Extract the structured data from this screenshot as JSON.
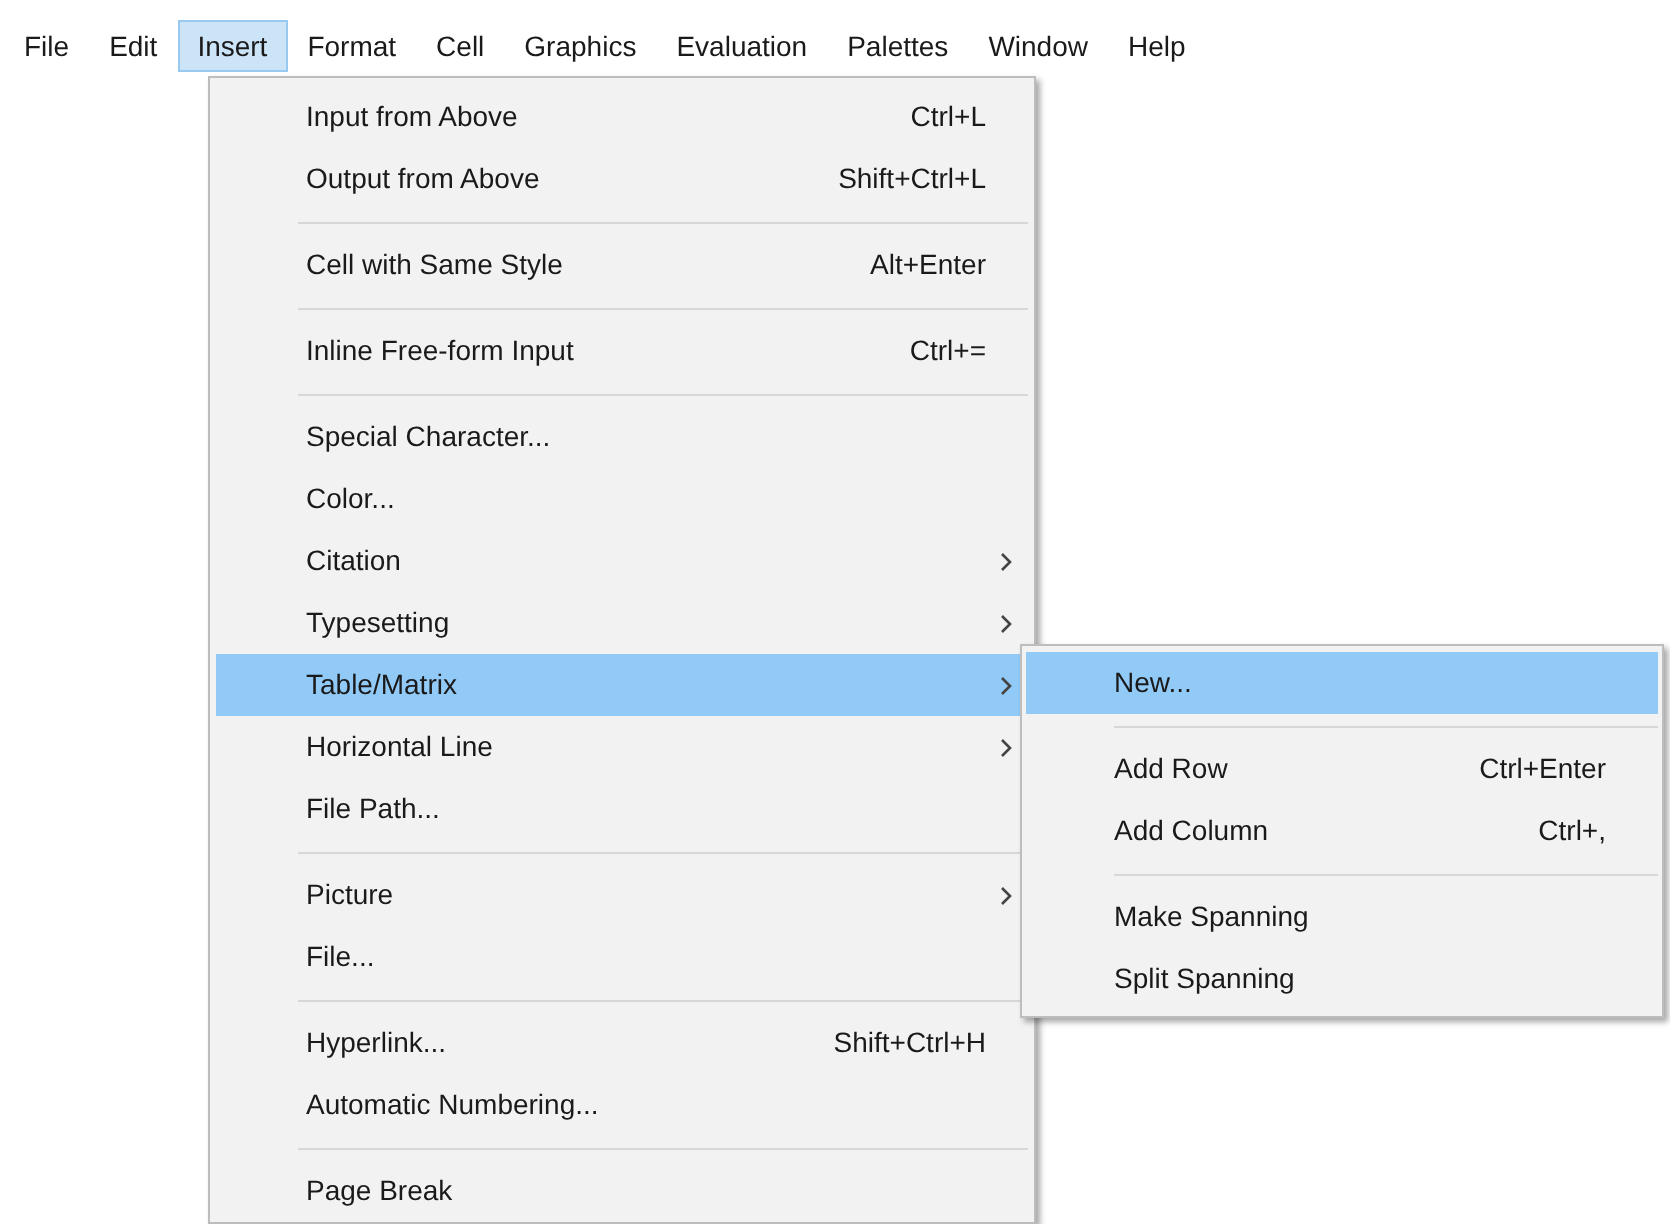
{
  "menubar": [
    {
      "label": "File",
      "selected": false
    },
    {
      "label": "Edit",
      "selected": false
    },
    {
      "label": "Insert",
      "selected": true
    },
    {
      "label": "Format",
      "selected": false
    },
    {
      "label": "Cell",
      "selected": false
    },
    {
      "label": "Graphics",
      "selected": false
    },
    {
      "label": "Evaluation",
      "selected": false
    },
    {
      "label": "Palettes",
      "selected": false
    },
    {
      "label": "Window",
      "selected": false
    },
    {
      "label": "Help",
      "selected": false
    }
  ],
  "menu": {
    "items": [
      {
        "kind": "item",
        "label": "Input from Above",
        "shortcut": "Ctrl+L",
        "submenu": false,
        "selected": false
      },
      {
        "kind": "item",
        "label": "Output from Above",
        "shortcut": "Shift+Ctrl+L",
        "submenu": false,
        "selected": false
      },
      {
        "kind": "separator"
      },
      {
        "kind": "item",
        "label": "Cell with Same Style",
        "shortcut": "Alt+Enter",
        "submenu": false,
        "selected": false
      },
      {
        "kind": "separator"
      },
      {
        "kind": "item",
        "label": "Inline Free-form Input",
        "shortcut": "Ctrl+=",
        "submenu": false,
        "selected": false
      },
      {
        "kind": "separator"
      },
      {
        "kind": "item",
        "label": "Special Character...",
        "submenu": false,
        "selected": false
      },
      {
        "kind": "item",
        "label": "Color...",
        "submenu": false,
        "selected": false
      },
      {
        "kind": "item",
        "label": "Citation",
        "submenu": true,
        "selected": false
      },
      {
        "kind": "item",
        "label": "Typesetting",
        "submenu": true,
        "selected": false
      },
      {
        "kind": "item",
        "label": "Table/Matrix",
        "submenu": true,
        "selected": true
      },
      {
        "kind": "item",
        "label": "Horizontal Line",
        "submenu": true,
        "selected": false
      },
      {
        "kind": "item",
        "label": "File Path...",
        "submenu": false,
        "selected": false
      },
      {
        "kind": "separator"
      },
      {
        "kind": "item",
        "label": "Picture",
        "submenu": true,
        "selected": false
      },
      {
        "kind": "item",
        "label": "File...",
        "submenu": false,
        "selected": false
      },
      {
        "kind": "separator"
      },
      {
        "kind": "item",
        "label": "Hyperlink...",
        "shortcut": "Shift+Ctrl+H",
        "submenu": false,
        "selected": false
      },
      {
        "kind": "item",
        "label": "Automatic Numbering...",
        "submenu": false,
        "selected": false
      },
      {
        "kind": "separator"
      },
      {
        "kind": "item",
        "label": "Page Break",
        "submenu": false,
        "selected": false
      }
    ]
  },
  "submenu": {
    "items": [
      {
        "kind": "item",
        "label": "New...",
        "submenu": false,
        "selected": true
      },
      {
        "kind": "separator"
      },
      {
        "kind": "item",
        "label": "Add Row",
        "shortcut": "Ctrl+Enter",
        "submenu": false,
        "selected": false
      },
      {
        "kind": "item",
        "label": "Add Column",
        "shortcut": "Ctrl+,",
        "submenu": false,
        "selected": false
      },
      {
        "kind": "separator"
      },
      {
        "kind": "item",
        "label": "Make Spanning",
        "submenu": false,
        "selected": false
      },
      {
        "kind": "item",
        "label": "Split Spanning",
        "submenu": false,
        "selected": false
      }
    ]
  }
}
